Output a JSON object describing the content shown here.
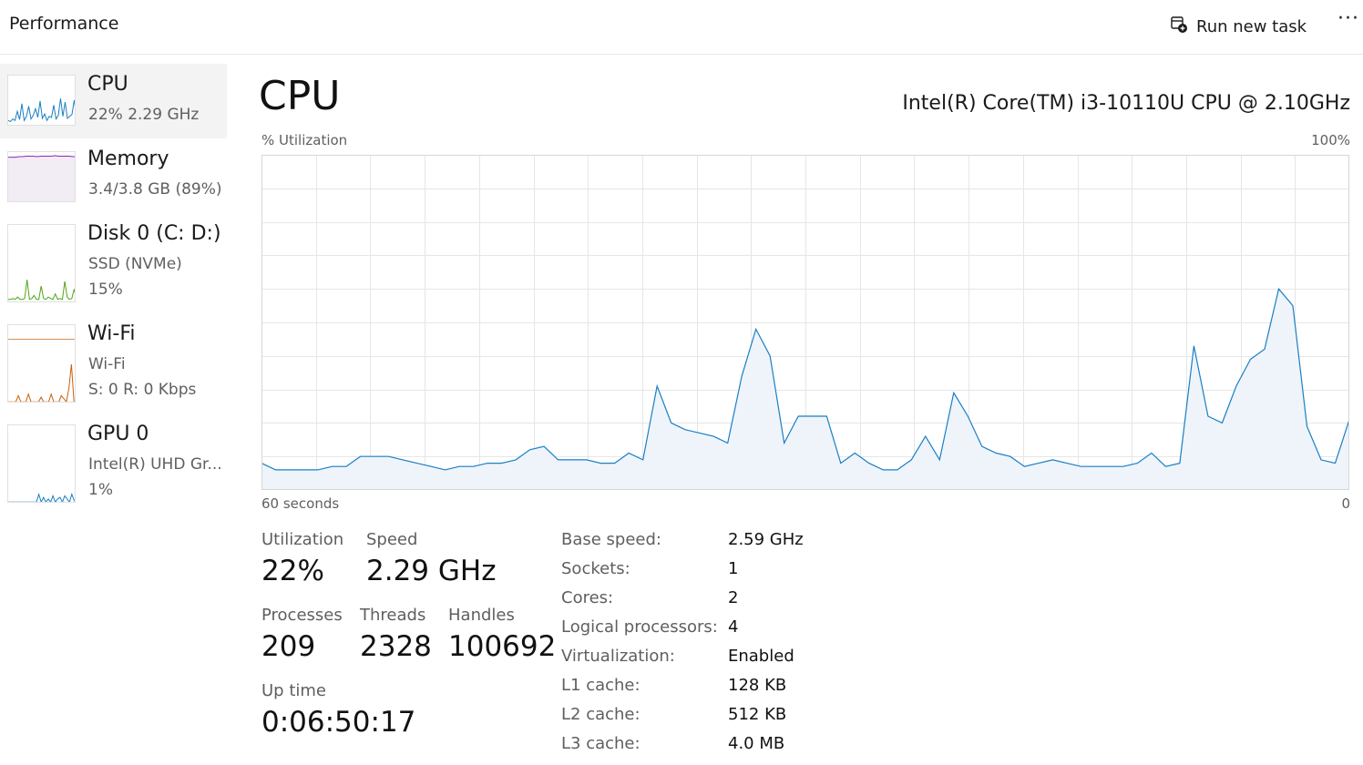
{
  "header": {
    "title": "Performance",
    "run_task_label": "Run new task",
    "more_label": "···"
  },
  "sidebar": {
    "items": [
      {
        "name": "CPU",
        "sub1": "22% 2.29 GHz",
        "sub2": "",
        "color": "#1a7fc4",
        "selected": true
      },
      {
        "name": "Memory",
        "sub1": "3.4/3.8 GB (89%)",
        "sub2": "",
        "color": "#8b2bb5",
        "selected": false
      },
      {
        "name": "Disk 0 (C: D:)",
        "sub1": "SSD (NVMe)",
        "sub2": "15%",
        "color": "#4da614",
        "selected": false
      },
      {
        "name": "Wi-Fi",
        "sub1": "Wi-Fi",
        "sub2": "S: 0 R: 0 Kbps",
        "color": "#c7620b",
        "selected": false
      },
      {
        "name": "GPU 0",
        "sub1": "Intel(R) UHD Gr...",
        "sub2": "1%",
        "color": "#1a7fc4",
        "selected": false
      }
    ]
  },
  "main": {
    "title": "CPU",
    "model": "Intel(R) Core(TM) i3-10110U CPU @ 2.10GHz",
    "graph": {
      "y_label": "% Utilization",
      "y_max_label": "100%",
      "x_left_label": "60 seconds",
      "x_right_label": "0",
      "line_color": "#1a7fc4",
      "fill_color": "#eef4fa",
      "values": [
        8,
        6,
        6,
        6,
        6,
        7,
        7,
        10,
        10,
        10,
        9,
        8,
        7,
        6,
        7,
        7,
        8,
        8,
        9,
        12,
        13,
        9,
        9,
        9,
        8,
        8,
        11,
        9,
        31,
        20,
        18,
        17,
        16,
        14,
        34,
        48,
        40,
        14,
        22,
        22,
        22,
        8,
        11,
        8,
        6,
        6,
        9,
        16,
        9,
        29,
        22,
        13,
        11,
        10,
        7,
        8,
        9,
        8,
        7,
        7,
        7,
        7,
        8,
        11,
        7,
        8,
        43,
        22,
        20,
        31,
        39,
        42,
        60,
        55,
        19,
        9,
        8,
        21
      ],
      "grid_rows": 10,
      "grid_cols": 20
    },
    "stats": {
      "utilization_label": "Utilization",
      "utilization_value": "22%",
      "speed_label": "Speed",
      "speed_value": "2.29 GHz",
      "processes_label": "Processes",
      "processes_value": "209",
      "threads_label": "Threads",
      "threads_value": "2328",
      "handles_label": "Handles",
      "handles_value": "100692",
      "uptime_label": "Up time",
      "uptime_value": "0:06:50:17"
    },
    "info": [
      {
        "key": "Base speed:",
        "value": "2.59 GHz"
      },
      {
        "key": "Sockets:",
        "value": "1"
      },
      {
        "key": "Cores:",
        "value": "2"
      },
      {
        "key": "Logical processors:",
        "value": "4"
      },
      {
        "key": "Virtualization:",
        "value": "Enabled"
      },
      {
        "key": "L1 cache:",
        "value": "128 KB"
      },
      {
        "key": "L2 cache:",
        "value": "512 KB"
      },
      {
        "key": "L3 cache:",
        "value": "4.0 MB"
      }
    ]
  }
}
